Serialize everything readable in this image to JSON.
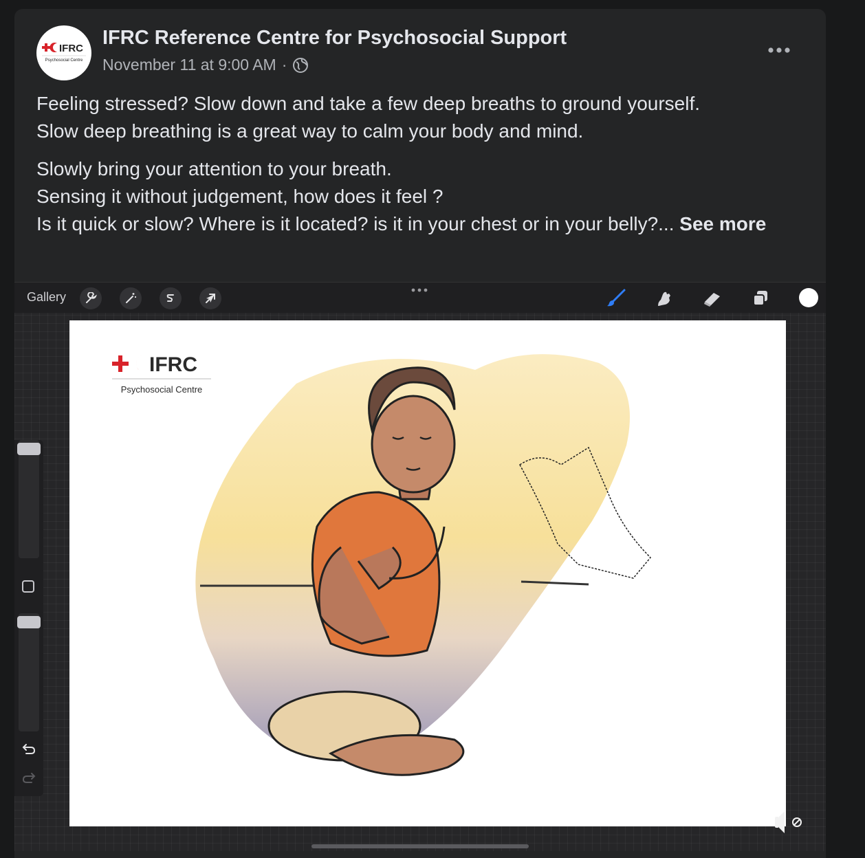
{
  "post": {
    "page_name": "IFRC Reference Centre for Psychosocial Support",
    "timestamp": "November 11 at 9:00 AM",
    "separator": "·",
    "audience_icon": "globe-icon",
    "more_icon": "more-horizontal-icon",
    "avatar": {
      "logo_text": "IFRC",
      "logo_subtext": "Psychosocial Centre"
    },
    "paragraphs": [
      "Feeling stressed? Slow down and take a few deep breaths to ground yourself. Slow deep breathing is a great way to calm your body and mind.",
      "Slowly bring your attention to your breath. Sensing it without judgement, how does it feel ? Is it quick or slow? Where is it located? is it in your chest or in your belly?..."
    ],
    "lines_p1": [
      "Feeling stressed? Slow down and take a few deep breaths to ground yourself.",
      "Slow deep breathing is a great way to calm your body and mind."
    ],
    "lines_p2": [
      "Slowly bring your attention to your breath.",
      "Sensing it without judgement, how does it feel ?",
      "Is it quick or slow? Where is it located? is it in your chest or in your belly?..."
    ],
    "see_more": "See more"
  },
  "media": {
    "toolbar": {
      "gallery_label": "Gallery",
      "left_tools": [
        "wrench-icon",
        "magic-wand-icon",
        "selection-icon",
        "transform-arrow-icon"
      ],
      "right_tools": [
        "brush-icon",
        "smudge-icon",
        "eraser-icon",
        "layers-icon",
        "color-icon"
      ],
      "active_tool_color": "#2f7df6",
      "current_color": "#ffffff"
    },
    "canvas": {
      "logo_text": "IFRC",
      "logo_subtext": "Psychosocial Centre",
      "logo_color": "#d8232a"
    },
    "sidebar": {
      "undo_icon": "undo-icon",
      "redo_icon": "redo-icon",
      "modify_icon": "square-icon"
    },
    "mute_icon": "sound-muted-icon"
  }
}
